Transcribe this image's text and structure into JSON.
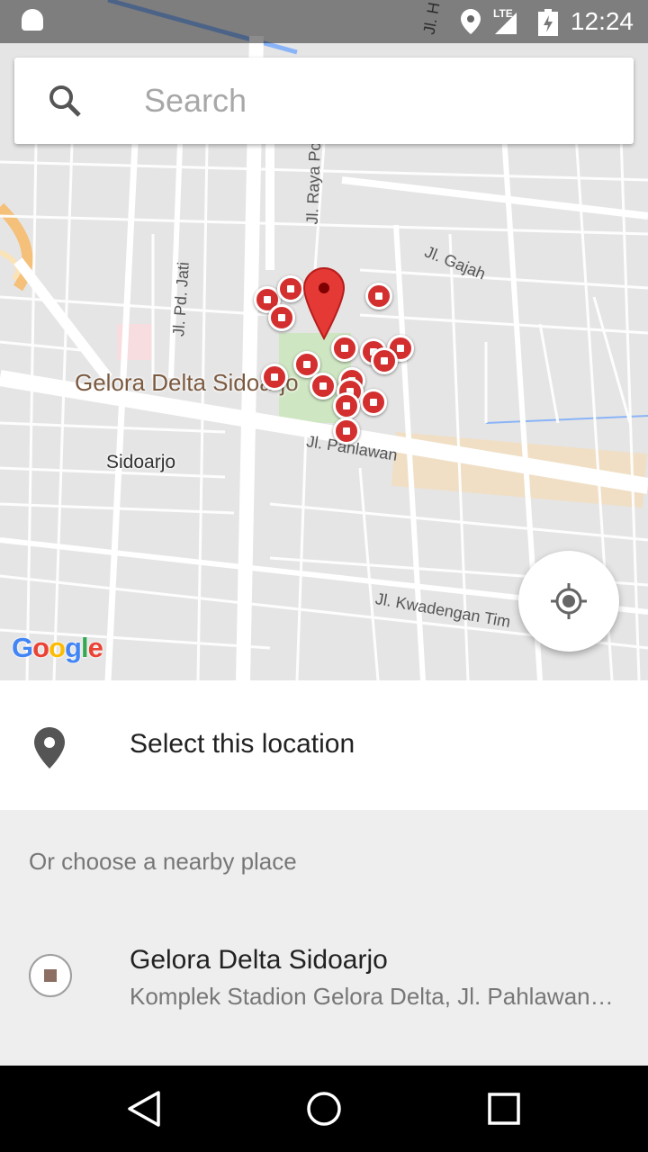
{
  "status_bar": {
    "time": "12:24",
    "network": "LTE",
    "icons": [
      "android-icon",
      "location-icon",
      "signal-icon",
      "battery-charging-icon"
    ]
  },
  "search": {
    "placeholder": "Search",
    "icon": "search-icon"
  },
  "map": {
    "labels": {
      "street_raya": "Jl. Raya Por",
      "street_gajah": "Jl. Gajah",
      "street_pd_jati": "Jl. Pd. Jati",
      "street_pahlawan": "Jl. Pahlawan",
      "street_kwadengan": "Jl. Kwadengan Tim",
      "street_top": "Jl. H",
      "area": "Gelora Delta Sidoarjo",
      "city": "Sidoarjo"
    },
    "logo": "Google",
    "marker_color": "#d32f2f",
    "locate_icon": "my-location-icon"
  },
  "select_location": {
    "label": "Select this location",
    "icon": "place-pin-icon"
  },
  "nearby": {
    "header": "Or choose a nearby place",
    "places": [
      {
        "name": "Gelora Delta Sidoarjo",
        "address": "Komplek Stadion Gelora Delta, Jl. Pahlawan, Sidoarjo"
      }
    ]
  },
  "nav_bar": {
    "buttons": [
      "back-icon",
      "home-icon",
      "recents-icon"
    ]
  }
}
